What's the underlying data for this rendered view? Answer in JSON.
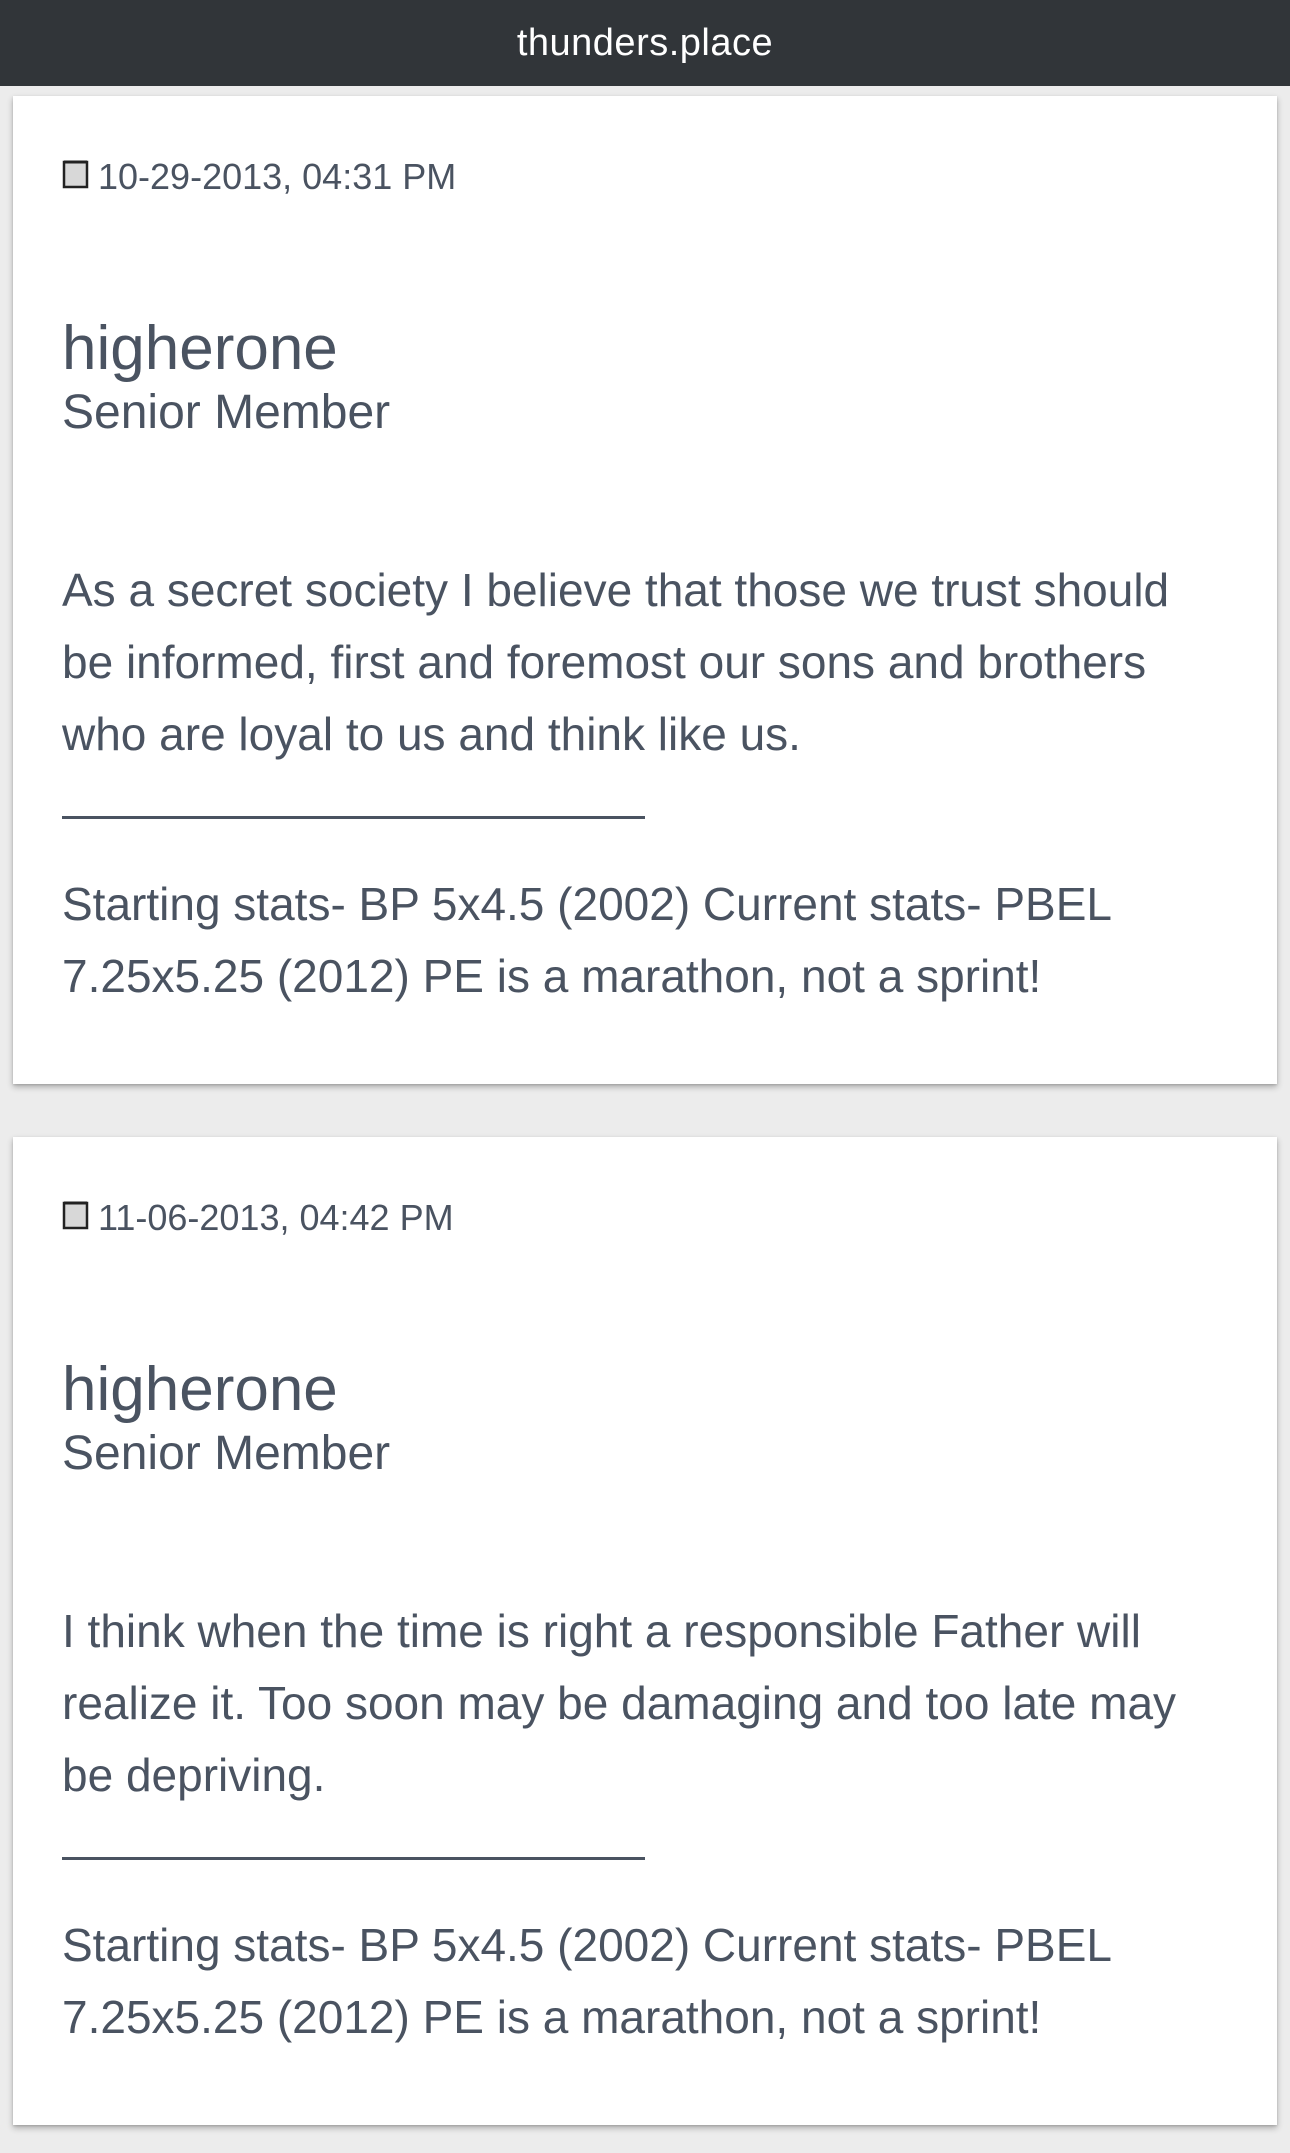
{
  "header": {
    "site_title": "thunders.place"
  },
  "posts": [
    {
      "date": "10-29-2013, 04:31 PM",
      "icon": "post-document-icon",
      "author": "higherone",
      "rank": "Senior Member",
      "message": "As a secret society I believe that those we trust should be informed, first and foremost our sons and brothers who are loyal to us and think like us.",
      "signature": "Starting stats- BP 5x4.5 (2002) Current stats- PBEL 7.25x5.25 (2012) PE is a marathon, not a sprint!"
    },
    {
      "date": "11-06-2013, 04:42 PM",
      "icon": "post-document-icon",
      "author": "higherone",
      "rank": "Senior Member",
      "message": "I think when the time is right a responsible Father will realize it. Too soon may be damaging and too late may be depriving.",
      "signature": "Starting stats- BP 5x4.5 (2002) Current stats- PBEL 7.25x5.25 (2012) PE is a marathon, not a sprint!"
    }
  ],
  "colors": {
    "topbar_bg": "#313539",
    "page_bg": "#ececec",
    "card_bg": "#ffffff",
    "text": "#4a5361"
  }
}
